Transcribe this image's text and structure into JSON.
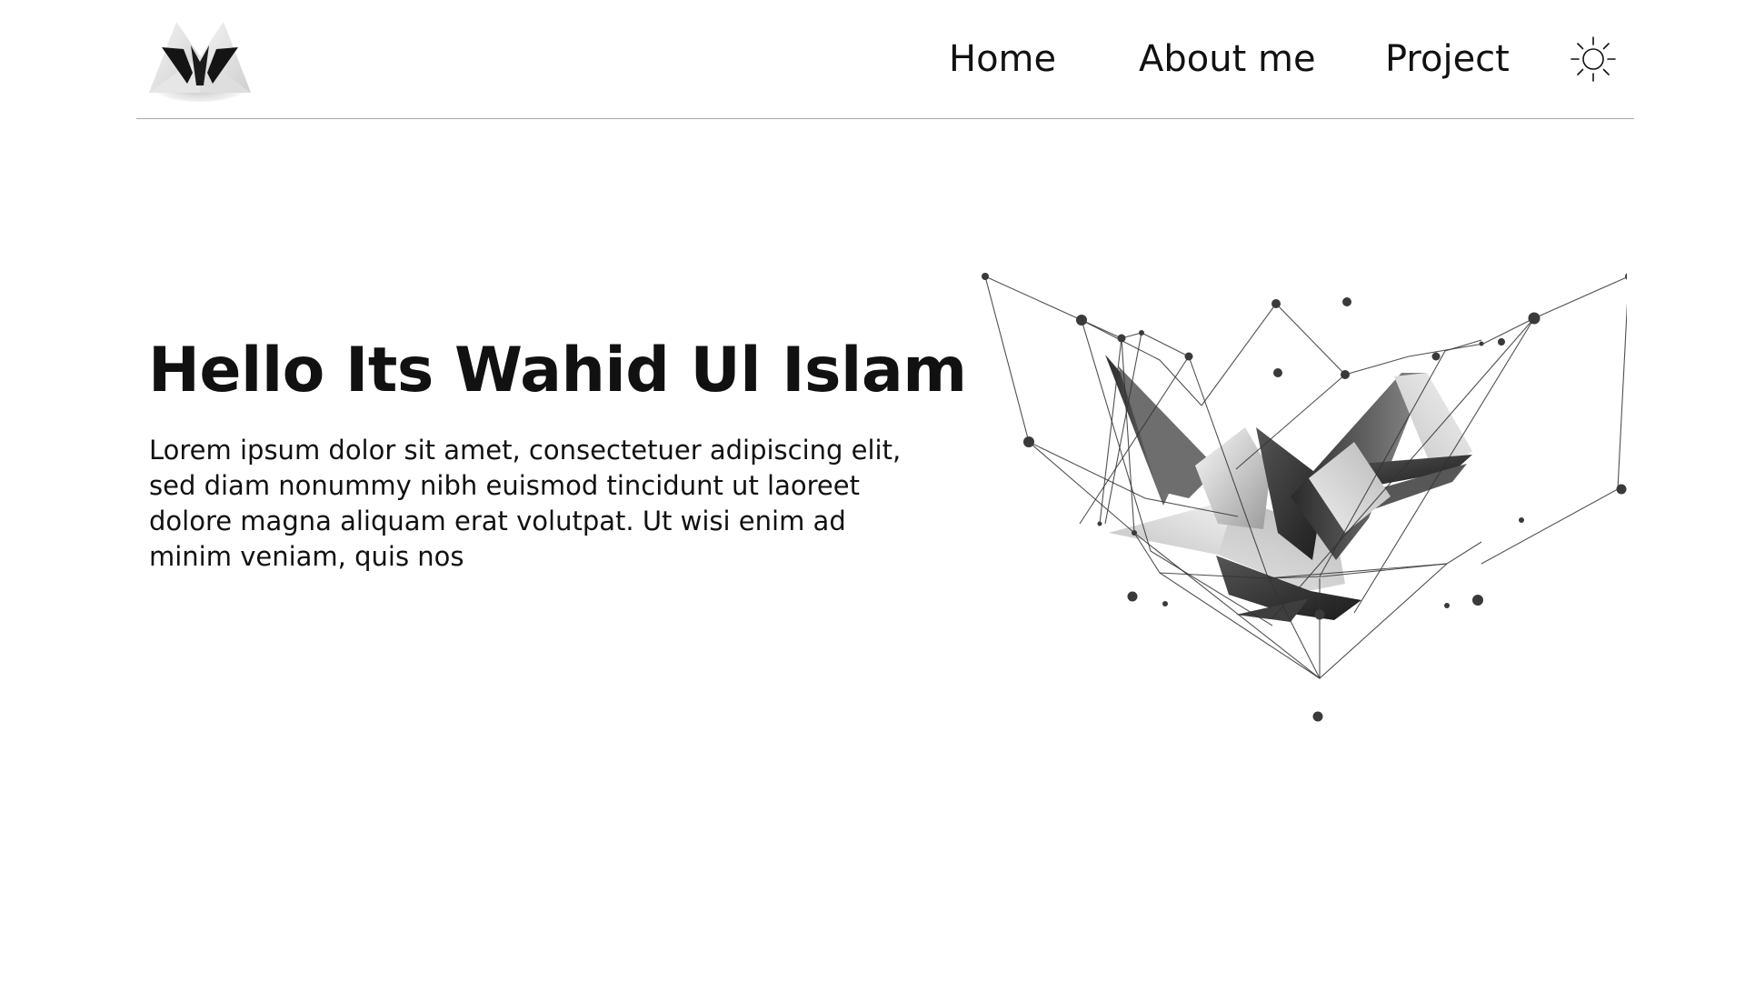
{
  "header": {
    "logo_icon": "wu-monogram-logo",
    "nav": [
      {
        "label": "Home"
      },
      {
        "label": "About me"
      },
      {
        "label": "Project"
      }
    ],
    "theme_toggle_icon": "sun-icon"
  },
  "hero": {
    "title_prefix": "Hello Its",
    "title_name": "Wahid Ul Islam",
    "description": "Lorem ipsum dolor sit amet, consectetuer adipiscing elit, sed diam nonummy nibh euismod tincidunt ut laoreet dolore magna aliquam erat volutpat. Ut wisi enim ad minim veniam, quis nos",
    "illustration_icon": "origami-crane-network-illustration"
  },
  "colors": {
    "background": "#ffffff",
    "text": "#111111",
    "divider": "#a8a8a8",
    "network_lines": "#333333"
  }
}
